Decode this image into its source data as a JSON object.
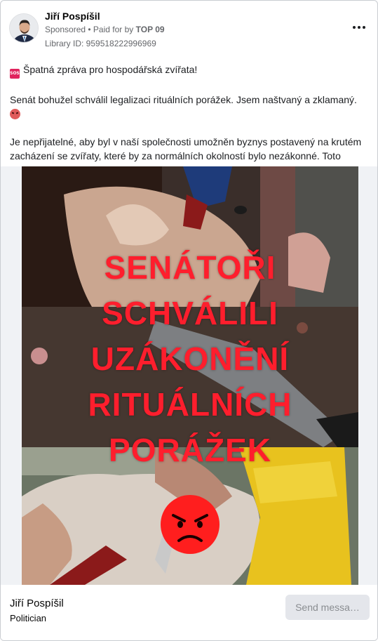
{
  "post": {
    "author": "Jiří Pospíšil",
    "sponsored_label": "Sponsored",
    "paid_for_prefix": " • Paid for by ",
    "sponsor": "TOP 09",
    "library_id": "Library ID: 959518222996969",
    "more_icon": "ellipsis-horizontal-icon",
    "avatar_icon": "profile-photo"
  },
  "body": {
    "line1_emoji": "SOS",
    "line1_emoji_icon": "sos-emoji-icon",
    "line1": "Špatná zpráva pro hospodářská zvířata!",
    "line2": "Senát bohužel schválil legalizaci rituálních porážek. Jsem naštvaný a zklamaný.",
    "line2_emoji_icon": "angry-face-emoji-icon",
    "line3": "Je nepřijatelné, aby byl v naší společnosti umožněn byznys postavený na krutém zacházení se zvířaty, které by za normálních okolností bylo nezákonné. Toto jsme…"
  },
  "creative": {
    "headline": [
      "SENÁTOŘI",
      "SCHVÁLILI",
      "UZÁKONĚNÍ",
      "RITUÁLNÍCH",
      "PORÁŽEK"
    ],
    "emoji_icon": "angry-face-icon",
    "headline_color": "#ff1e2d",
    "emoji_color": "#ff1e1e"
  },
  "footer": {
    "page_name": "Jiří Pospíšil",
    "page_category": "Politician",
    "cta_label": "Send messa…"
  }
}
